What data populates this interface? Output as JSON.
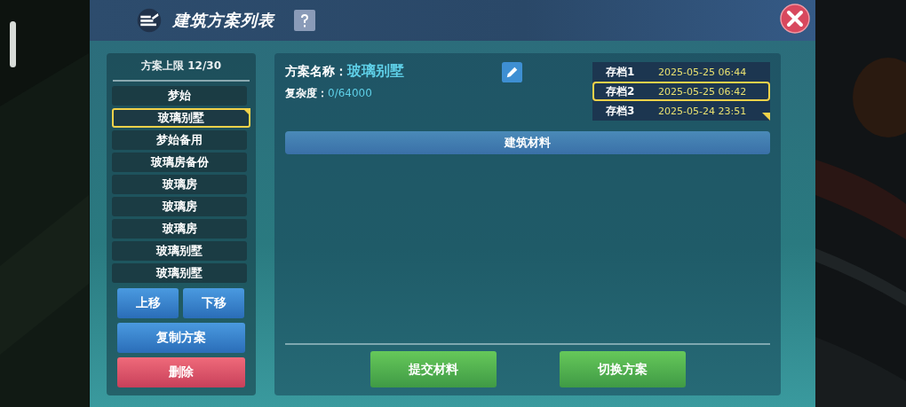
{
  "window": {
    "title": "建筑方案列表"
  },
  "sidebar": {
    "capacity": "方案上限 12/30",
    "plans": [
      {
        "name": "梦始",
        "selected": false,
        "flagged": false
      },
      {
        "name": "玻璃别墅",
        "selected": true,
        "flagged": true
      },
      {
        "name": "梦始备用",
        "selected": false,
        "flagged": false
      },
      {
        "name": "玻璃房备份",
        "selected": false,
        "flagged": false
      },
      {
        "name": "玻璃房",
        "selected": false,
        "flagged": false
      },
      {
        "name": "玻璃房",
        "selected": false,
        "flagged": false
      },
      {
        "name": "玻璃房",
        "selected": false,
        "flagged": false
      },
      {
        "name": "玻璃别墅",
        "selected": false,
        "flagged": false
      },
      {
        "name": "玻璃别墅",
        "selected": false,
        "flagged": false
      }
    ],
    "buttons": [
      {
        "label": "上移",
        "kind": "half"
      },
      {
        "label": "下移",
        "kind": "half"
      },
      {
        "label": "复制方案",
        "kind": "wide"
      },
      {
        "label": "删除",
        "kind": "danger"
      }
    ]
  },
  "detail": {
    "name_label": "方案名称：",
    "name_value": "玻璃别墅",
    "complexity_label": "复杂度：",
    "complexity_value": "0/64000",
    "saves": [
      {
        "label": "存档1",
        "time": "2025-05-25 06:44",
        "selected": false,
        "flagged": false
      },
      {
        "label": "存档2",
        "time": "2025-05-25 06:42",
        "selected": true,
        "flagged": false
      },
      {
        "label": "存档3",
        "time": "2025-05-24 23:51",
        "selected": false,
        "flagged": true
      }
    ],
    "materials_header": "建筑材料",
    "buttons": [
      "提交材料",
      "切换方案"
    ]
  }
}
